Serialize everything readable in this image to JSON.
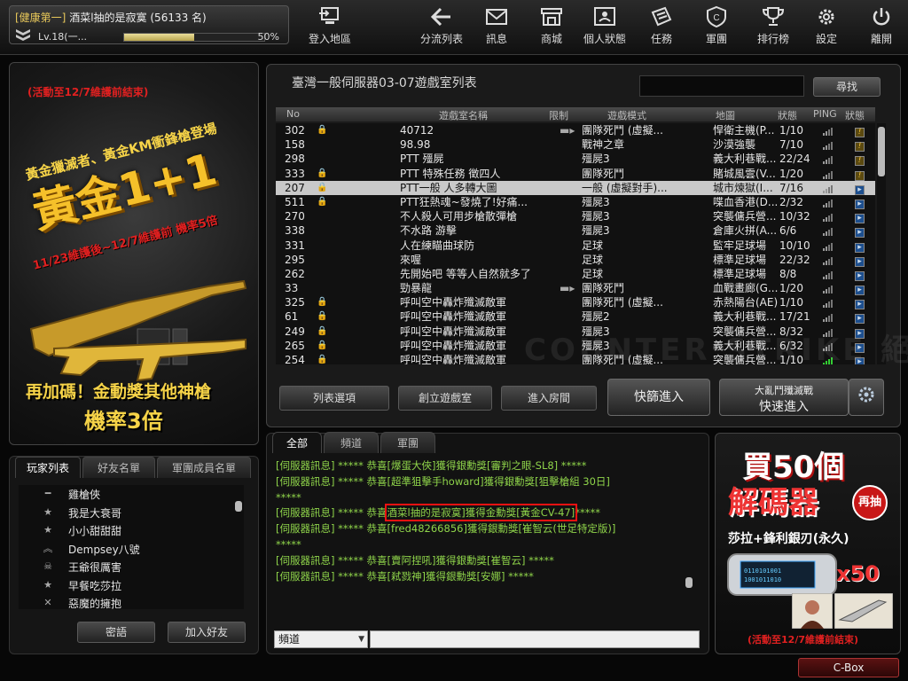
{
  "player": {
    "name_line": "[健康第一] 酒菜l抽的是寂寞 (56133 名)",
    "clan": "[健康第一]",
    "nickname": "酒菜l抽的是寂寞",
    "ranking": "(56133 名)",
    "level": "Lv.18(一...",
    "exp_percent_label": "50%",
    "exp_fraction": 0.5
  },
  "nav": [
    {
      "label": "登入地區",
      "icon": "login-area-icon"
    },
    {
      "label": "分流列表",
      "icon": "back-arrow-icon"
    },
    {
      "label": "訊息",
      "icon": "mail-icon"
    },
    {
      "label": "商城",
      "icon": "shop-icon"
    },
    {
      "label": "個人狀態",
      "icon": "profile-card-icon"
    },
    {
      "label": "任務",
      "icon": "mission-icon"
    },
    {
      "label": "軍團",
      "icon": "clan-shield-icon"
    },
    {
      "label": "排行榜",
      "icon": "trophy-icon"
    },
    {
      "label": "設定",
      "icon": "gear-icon"
    },
    {
      "label": "離開",
      "icon": "power-icon"
    }
  ],
  "ad_left": {
    "top_note": "(活動至12/7維護前結束)",
    "line1": "黃金獵滅者、黃金KM衝鋒槍登場",
    "big": "黃金1+1",
    "date_line": "11/23維護後~12/7維護前 機率5倍",
    "line3": "再加碼！金動獎其他神槍",
    "line4": "機率3倍"
  },
  "room_list": {
    "title": "臺灣一般伺服器03-07遊戲室列表",
    "search_button": "尋找",
    "search_value": "",
    "columns": [
      "No",
      "遊戲室名稱",
      "限制",
      "遊戲模式",
      "地圖",
      "狀態",
      "PING",
      "狀態"
    ],
    "rows": [
      {
        "no": "302",
        "locked": true,
        "name": "40712",
        "limit": "knife",
        "mode": "團隊死鬥 (虛擬...",
        "map": "悍衛主機(P...",
        "status": "1/10",
        "ping": 2,
        "flag": "wait",
        "selected": false
      },
      {
        "no": "158",
        "locked": false,
        "name": "98.98",
        "limit": "",
        "mode": "戰神之章",
        "map": "沙漠強襲",
        "status": "7/10",
        "ping": 2,
        "flag": "wait",
        "selected": false
      },
      {
        "no": "298",
        "locked": false,
        "name": "PTT 殭屍",
        "limit": "",
        "mode": "殭屍3",
        "map": "義大利巷戰...",
        "status": "22/24",
        "ping": 2,
        "flag": "wait",
        "selected": false
      },
      {
        "no": "333",
        "locked": true,
        "name": "PTT 特殊任務 徵四人",
        "limit": "",
        "mode": "團隊死鬥",
        "map": "賭城風雲(V...",
        "status": "1/20",
        "ping": 2,
        "flag": "wait",
        "selected": false
      },
      {
        "no": "207",
        "locked": true,
        "name": "PTT一般 人多轉大圖",
        "limit": "",
        "mode": "一般 (虛擬對手)...",
        "map": "城市煉獄(I...",
        "status": "7/16",
        "ping": 2,
        "flag": "play",
        "selected": true
      },
      {
        "no": "511",
        "locked": true,
        "name": "PTT狂熱魂~發燒了!好痛...",
        "limit": "",
        "mode": "殭屍3",
        "map": "喋血香港(D...",
        "status": "2/32",
        "ping": 2,
        "flag": "play",
        "selected": false
      },
      {
        "no": "270",
        "locked": false,
        "name": "不人殺人可用步槍散彈槍",
        "limit": "",
        "mode": "殭屍3",
        "map": "突襲傭兵營...",
        "status": "10/32",
        "ping": 2,
        "flag": "play",
        "selected": false
      },
      {
        "no": "338",
        "locked": false,
        "name": "不水路 游擊",
        "limit": "",
        "mode": "殭屍3",
        "map": "倉庫火拼(A...",
        "status": "6/6",
        "ping": 2,
        "flag": "play",
        "selected": false
      },
      {
        "no": "331",
        "locked": false,
        "name": "人在練瞄曲球防",
        "limit": "",
        "mode": "足球",
        "map": "監牢足球場",
        "status": "10/10",
        "ping": 2,
        "flag": "play",
        "selected": false
      },
      {
        "no": "295",
        "locked": false,
        "name": "來喔",
        "limit": "",
        "mode": "足球",
        "map": "標準足球場",
        "status": "22/32",
        "ping": 2,
        "flag": "play",
        "selected": false
      },
      {
        "no": "262",
        "locked": false,
        "name": "先開始吧 等等人自然就多了",
        "limit": "",
        "mode": "足球",
        "map": "標準足球場",
        "status": "8/8",
        "ping": 2,
        "flag": "play",
        "selected": false
      },
      {
        "no": "33",
        "locked": false,
        "name": "勁暴龍",
        "limit": "knife",
        "mode": "團隊死鬥",
        "map": "血戰畫廊(G...",
        "status": "1/20",
        "ping": 2,
        "flag": "play",
        "selected": false
      },
      {
        "no": "325",
        "locked": true,
        "name": "呼叫空中轟炸殲滅敵軍",
        "limit": "",
        "mode": "團隊死鬥 (虛擬...",
        "map": "赤熱陽台(AE)",
        "status": "1/10",
        "ping": 2,
        "flag": "play",
        "selected": false
      },
      {
        "no": "61",
        "locked": true,
        "name": "呼叫空中轟炸殲滅敵軍",
        "limit": "",
        "mode": "殭屍2",
        "map": "義大利巷戰...",
        "status": "17/21",
        "ping": 2,
        "flag": "play",
        "selected": false
      },
      {
        "no": "249",
        "locked": true,
        "name": "呼叫空中轟炸殲滅敵軍",
        "limit": "",
        "mode": "殭屍3",
        "map": "突襲傭兵營...",
        "status": "8/32",
        "ping": 2,
        "flag": "play",
        "selected": false
      },
      {
        "no": "265",
        "locked": true,
        "name": "呼叫空中轟炸殲滅敵軍",
        "limit": "",
        "mode": "殭屍3",
        "map": "義大利巷戰...",
        "status": "6/32",
        "ping": 2,
        "flag": "play",
        "selected": false
      },
      {
        "no": "254",
        "locked": true,
        "name": "呼叫空中轟炸殲滅敵軍",
        "limit": "",
        "mode": "團隊死鬥 (虛擬...",
        "map": "突襲傭兵營...",
        "status": "1/10",
        "ping": 4,
        "flag": "play",
        "selected": false
      }
    ],
    "watermark": "COUNTER STRIKE 絕對武力",
    "buttons": {
      "list_options": "列表選項",
      "create_room": "創立遊戲室",
      "enter_room": "進入房間",
      "quick_join": "快篩進入",
      "mode_name": "大亂鬥殲滅戰",
      "quick_enter": "快速進入"
    }
  },
  "friends": {
    "tabs": [
      "玩家列表",
      "好友名單",
      "軍團成員名單"
    ],
    "items": [
      {
        "name": "雞槍俠",
        "rank_icon": "rank-bar-icon"
      },
      {
        "name": "我是大衰哥",
        "rank_icon": "rank-star-icon"
      },
      {
        "name": "小小甜甜甜",
        "rank_icon": "rank-star-icon"
      },
      {
        "name": "Dempsey八號",
        "rank_icon": "rank-chevron-icon"
      },
      {
        "name": "王爺很厲害",
        "rank_icon": "rank-skull-icon"
      },
      {
        "name": "早餐吃莎拉",
        "rank_icon": "rank-star-icon"
      },
      {
        "name": "惡魔的擁抱",
        "rank_icon": "rank-cross-icon"
      }
    ],
    "password_button": "密語",
    "add_friend_button": "加入好友"
  },
  "chat": {
    "tabs": [
      "全部",
      "頻道",
      "軍團"
    ],
    "lines": [
      {
        "text": "[伺服器訊息] ***** 恭喜[爆蛋大俠]獲得銀勳獎[審判之眼-SL8] *****",
        "highlight": false
      },
      {
        "text": "[伺服器訊息] ***** 恭喜[超準狙擊手howard]獲得銀勳獎[狙擊槍組 30日]",
        "highlight": false
      },
      {
        "text": "*****",
        "highlight": false
      },
      {
        "text": "[伺服器訊息] ***** 恭喜",
        "highlight_text": "酒菜l抽的是寂寞]獲得金勳獎[黃金CV-47]",
        "tail": "*****",
        "highlight": true
      },
      {
        "text": "[伺服器訊息] ***** 恭喜[fred48266856]獲得銀勳獎[崔智云(世足特定版)]",
        "highlight": false
      },
      {
        "text": "*****",
        "highlight": false
      },
      {
        "text": "[伺服器訊息] ***** 恭喜[賣阿捏吼]獲得銀勳獎[崔智云] *****",
        "highlight": false
      },
      {
        "text": "[伺服器訊息] ***** 恭喜[弒戮神]獲得銀勳獎[安娜] *****",
        "highlight": false
      }
    ],
    "channel_select": "頻道",
    "input_value": ""
  },
  "ad_right": {
    "line1": "買50個",
    "line2": "解碼器",
    "badge": "再抽",
    "line3": "莎拉+鋒利銀刃(永久)",
    "count": "x50",
    "note": "(活動至12/7維護前結束)"
  },
  "cbox_button": "C-Box",
  "colors": {
    "chat_text": "#8fd44a",
    "gold": "#f2c12e",
    "ad_red": "#d91c1c",
    "highlight_box": "#e11111"
  }
}
